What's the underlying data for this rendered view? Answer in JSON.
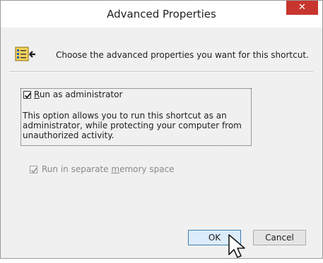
{
  "window": {
    "title": "Advanced Properties",
    "close_glyph": "✕"
  },
  "header": {
    "icon": "shortcut-properties-icon",
    "text": "Choose the advanced properties you want for this shortcut."
  },
  "options": {
    "run_as_admin": {
      "label_prefix": "R",
      "label_rest": "un as administrator",
      "checked": true,
      "description_lines": [
        "This option allows you to run this shortcut as an",
        "administrator, while protecting your computer from",
        "unauthorized activity."
      ]
    },
    "separate_memory": {
      "label_before": "Run in separate ",
      "label_accel": "m",
      "label_after": "emory space",
      "checked": true,
      "disabled": true
    }
  },
  "buttons": {
    "ok": "OK",
    "cancel": "Cancel"
  },
  "colors": {
    "close_button": "#c7352e",
    "dialog_background": "#f0f0f0",
    "default_button_border": "#3c7fb1"
  }
}
